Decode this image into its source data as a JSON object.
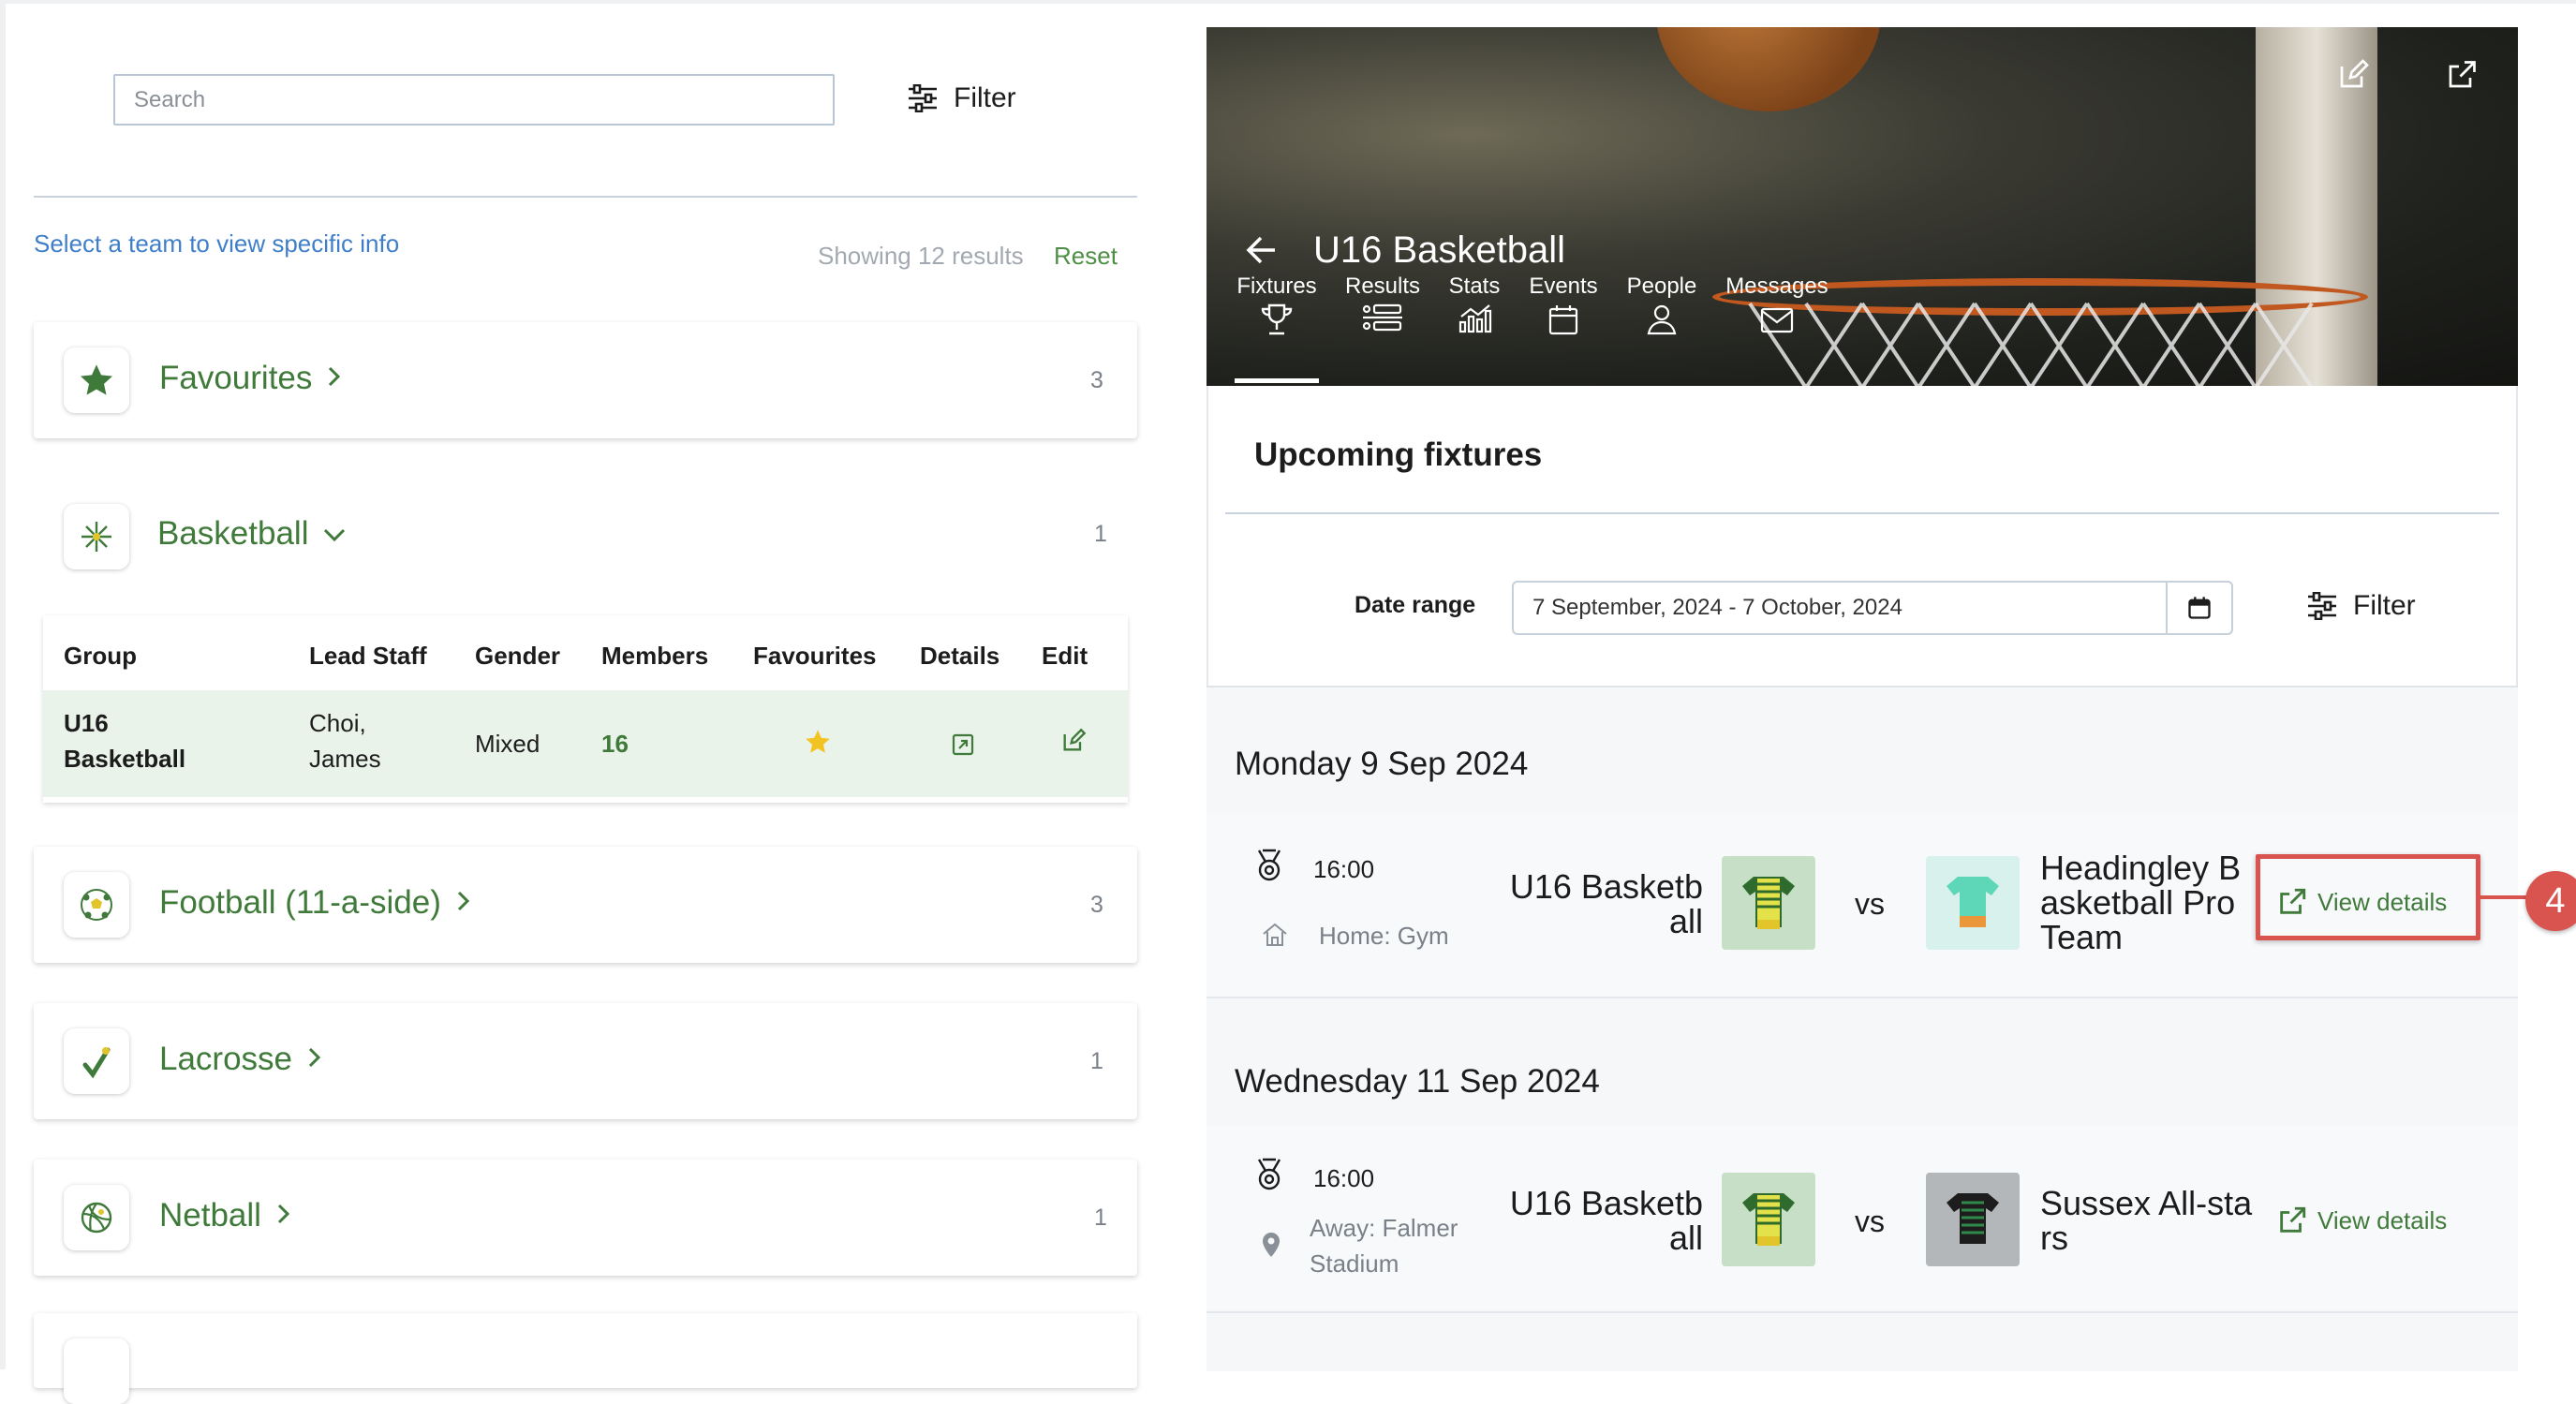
{
  "left": {
    "search": {
      "placeholder": "Search"
    },
    "filter_label": "Filter",
    "hint": "Select a team to view specific info",
    "showing": "Showing 12 results",
    "reset": "Reset",
    "groups": [
      {
        "name": "Favourites",
        "count": "3",
        "icon": "star-icon"
      },
      {
        "name": "Basketball",
        "count": "1",
        "icon": "basketball-icon"
      },
      {
        "name": "Football (11-a-side)",
        "count": "3",
        "icon": "football-icon"
      },
      {
        "name": "Lacrosse",
        "count": "1",
        "icon": "lacrosse-icon"
      },
      {
        "name": "Netball",
        "count": "1",
        "icon": "netball-icon"
      }
    ],
    "table": {
      "headers": [
        "Group",
        "Lead Staff",
        "Gender",
        "Members",
        "Favourites",
        "Details",
        "Edit"
      ],
      "row": {
        "group_line1": "U16",
        "group_line2": "Basketball",
        "staff_line1": "Choi,",
        "staff_line2": "James",
        "gender": "Mixed",
        "members": "16"
      }
    }
  },
  "right": {
    "team_title": "U16 Basketball",
    "tabs": [
      {
        "label": "Fixtures",
        "icon": "trophy-icon"
      },
      {
        "label": "Results",
        "icon": "results-icon"
      },
      {
        "label": "Stats",
        "icon": "stats-icon"
      },
      {
        "label": "Events",
        "icon": "calendar-icon"
      },
      {
        "label": "People",
        "icon": "person-icon"
      },
      {
        "label": "Messages",
        "icon": "envelope-icon"
      }
    ],
    "section_title": "Upcoming fixtures",
    "date_range_label": "Date range",
    "date_range_value": "7 September, 2024 - 7 October, 2024",
    "filter_label": "Filter",
    "days": [
      {
        "heading": "Monday 9 Sep 2024",
        "time": "16:00",
        "venue_line1": "Home: Gym",
        "venue_line2": "",
        "home_line1": "U16 Basketb",
        "home_line2": "all",
        "vs": "vs",
        "away_line1": "Headingley B",
        "away_line2": "asketball Pro",
        "away_line3": "Team",
        "view": "View details"
      },
      {
        "heading": "Wednesday 11 Sep 2024",
        "time": "16:00",
        "venue_line1": "Away: Falmer",
        "venue_line2": "Stadium",
        "home_line1": "U16 Basketb",
        "home_line2": "all",
        "vs": "vs",
        "away_line1": "Sussex All-sta",
        "away_line2": "rs",
        "view": "View details"
      }
    ],
    "step_number": "4"
  },
  "colors": {
    "brand_green": "#3f7a3a",
    "link_blue": "#3f7fc9",
    "highlight_red": "#d9534f"
  }
}
